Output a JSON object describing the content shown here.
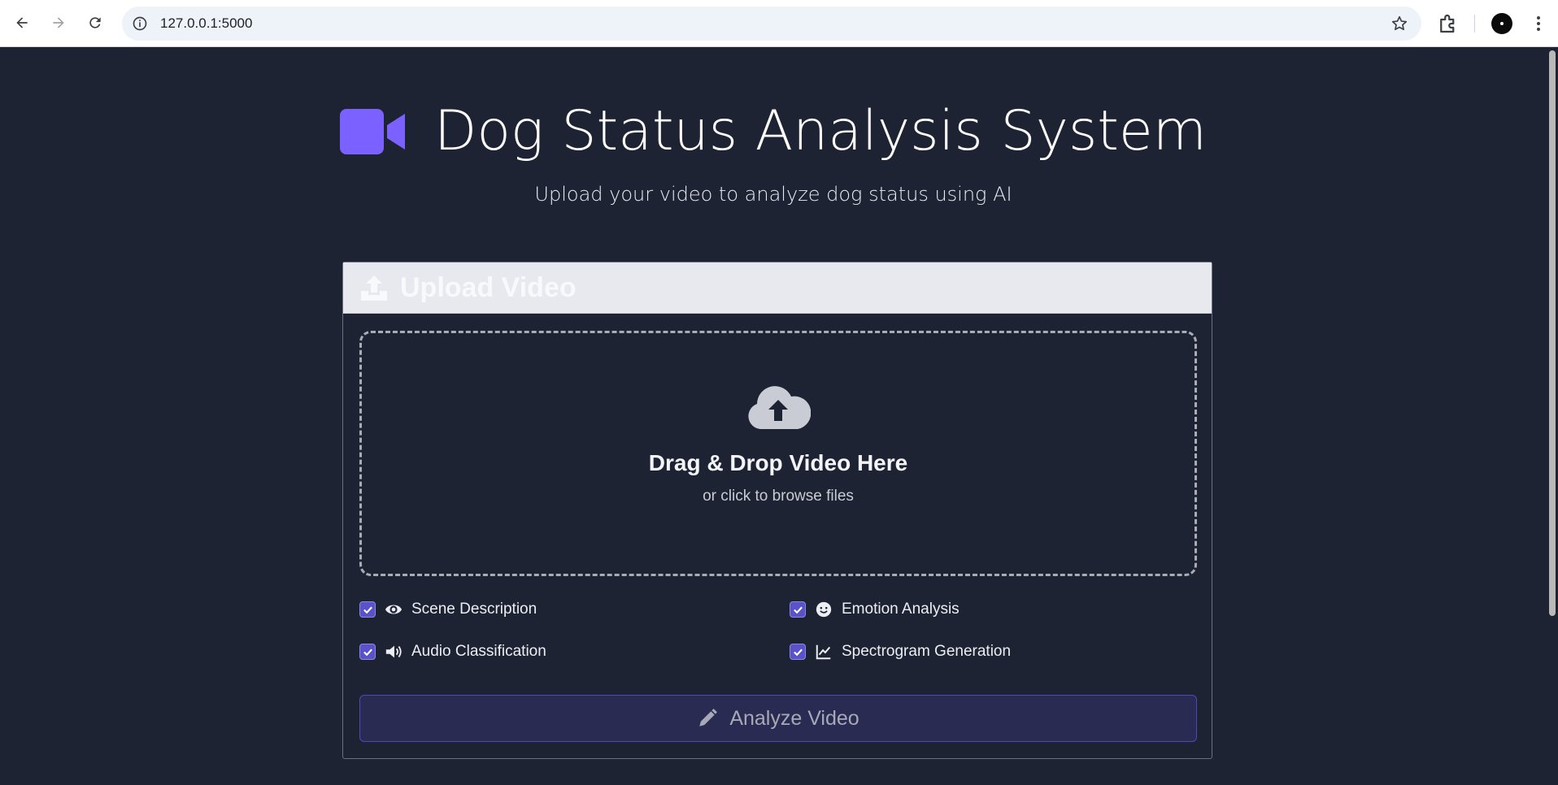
{
  "browser": {
    "url": "127.0.0.1:5000"
  },
  "header": {
    "title": "Dog Status Analysis System",
    "subtitle": "Upload your video to analyze dog status using AI",
    "icon": "video-camera-icon",
    "accent": "#7b61ff"
  },
  "upload_card": {
    "title": "Upload Video",
    "dropzone": {
      "title": "Drag & Drop Video Here",
      "subtitle": "or click to browse files"
    },
    "options": [
      {
        "label": "Scene Description",
        "icon": "eye-icon",
        "checked": true
      },
      {
        "label": "Emotion Analysis",
        "icon": "smile-icon",
        "checked": true
      },
      {
        "label": "Audio Classification",
        "icon": "volume-icon",
        "checked": true
      },
      {
        "label": "Spectrogram Generation",
        "icon": "chart-line-icon",
        "checked": true
      }
    ],
    "analyze_button": "Analyze Video"
  }
}
